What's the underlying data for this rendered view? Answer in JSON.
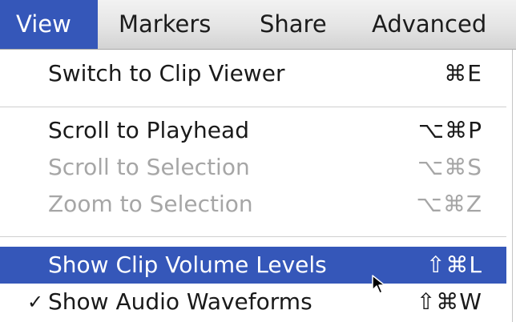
{
  "menubar": {
    "items": [
      {
        "label": "View",
        "active": true
      },
      {
        "label": "Markers",
        "active": false
      },
      {
        "label": "Share",
        "active": false
      },
      {
        "label": "Advanced",
        "active": false
      }
    ]
  },
  "menu": {
    "items": [
      {
        "label": "Switch to Clip Viewer",
        "shortcut": "⌘E",
        "enabled": true
      },
      {
        "label": "Scroll to Playhead",
        "shortcut": "⌥⌘P",
        "enabled": true
      },
      {
        "label": "Scroll to Selection",
        "shortcut": "⌥⌘S",
        "enabled": false
      },
      {
        "label": "Zoom to Selection",
        "shortcut": "⌥⌘Z",
        "enabled": false
      },
      {
        "label": "Show Clip Volume Levels",
        "shortcut": "⇧⌘L",
        "enabled": true,
        "highlighted": true
      },
      {
        "label": "Show Audio Waveforms",
        "shortcut": "⇧⌘W",
        "enabled": true,
        "checked": true,
        "check_mark": "✓"
      }
    ]
  },
  "colors": {
    "highlight": "#3557b9",
    "disabled_text": "#a6a6a6",
    "menubar_background": "#e4e4e4"
  },
  "icons": {
    "cursor": "arrow-pointer-icon",
    "check": "checkmark-icon"
  }
}
